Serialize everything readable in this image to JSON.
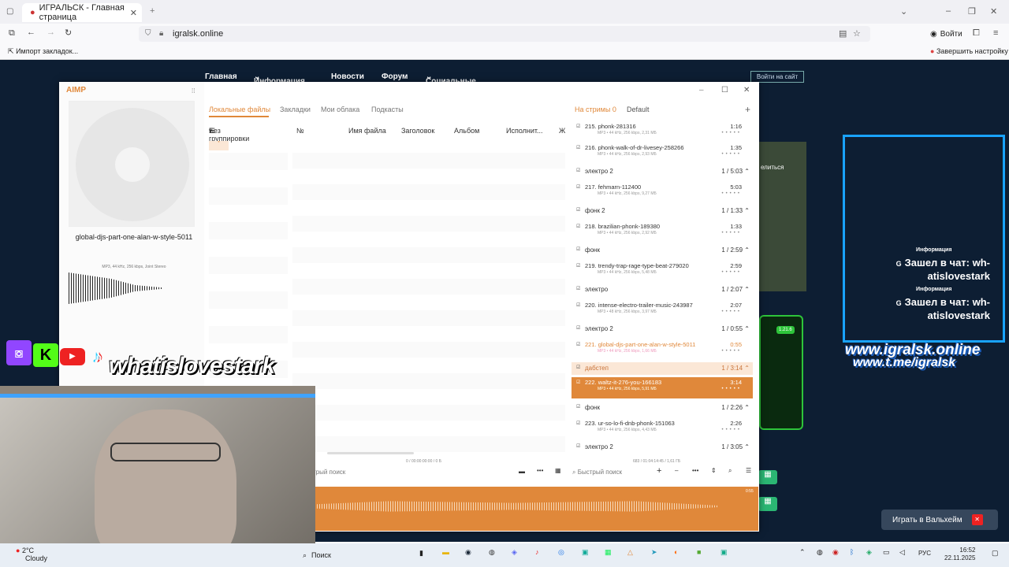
{
  "browser": {
    "tab_title": "ИГРАЛЬСК - Главная страница",
    "url": "igralsk.online",
    "login_label": "Войти",
    "import_bookmarks": "Импорт закладок...",
    "finish_setup": "Завершить настройку"
  },
  "site": {
    "nav": [
      "Главная",
      "Информация",
      "Новости",
      "Форум",
      "Социальные сети"
    ],
    "login_button": "Войти на сайт",
    "play_button": "Играть в Вальхейм",
    "side_text": "елиться",
    "version_badge": "1.21.6"
  },
  "aimp": {
    "logo": "AIMP",
    "now_playing_title": "global-djs-part-one-alan-w-style-5011",
    "now_playing_meta": "MP3, 44 kHz, 256 kbps, Joint Stereo",
    "tabs": [
      "Локальные файлы",
      "Закладки",
      "Мои облака",
      "Подкасты"
    ],
    "group_label": "Без группировки",
    "columns": [
      "№",
      "Имя файла",
      "Заголовок",
      "Альбом",
      "Исполнит...",
      "Ж"
    ],
    "playlist_tabs": [
      "На стримы 0",
      "Default"
    ],
    "library_status": "0 / 00:00:00:00 / 0 Б",
    "playlist_status": "683 / 01:04:14:45 / 1,61 ГБ",
    "quick_search_left": "Быстрый поиск",
    "quick_search_right": "Быстрый поиск",
    "wave_time": "0:55",
    "playlist": [
      {
        "kind": "track",
        "num": "215.",
        "name": "phonk-281316",
        "dur": "1:16",
        "meta": "MP3 • 44 kHz, 256 kbps, 2,31 МБ"
      },
      {
        "kind": "track",
        "num": "216.",
        "name": "phonk-walk-of-dr-livesey-258266",
        "dur": "1:35",
        "meta": "MP3 • 44 kHz, 256 kbps, 2,93 МБ"
      },
      {
        "kind": "group",
        "name": "электро 2",
        "dur": "1 / 5:03"
      },
      {
        "kind": "track",
        "num": "217.",
        "name": "fehmarn-112400",
        "dur": "5:03",
        "meta": "MP3 • 44 kHz, 256 kbps, 9,27 МБ"
      },
      {
        "kind": "group",
        "name": "фонк 2",
        "dur": "1 / 1:33"
      },
      {
        "kind": "track",
        "num": "218.",
        "name": "brazilian-phonk-189380",
        "dur": "1:33",
        "meta": "MP3 • 44 kHz, 256 kbps, 2,92 МБ"
      },
      {
        "kind": "group",
        "name": "фонк",
        "dur": "1 / 2:59"
      },
      {
        "kind": "track",
        "num": "219.",
        "name": "trendy-trap-rage-type-beat-279020",
        "dur": "2:59",
        "meta": "MP3 • 44 kHz, 256 kbps, 5,48 МБ"
      },
      {
        "kind": "group",
        "name": "электро",
        "dur": "1 / 2:07"
      },
      {
        "kind": "track",
        "num": "220.",
        "name": "intense-electro-trailer-music-243987",
        "dur": "2:07",
        "meta": "MP3 • 48 kHz, 256 kbps, 3,97 МБ"
      },
      {
        "kind": "group",
        "name": "электро 2",
        "dur": "1 / 0:55"
      },
      {
        "kind": "track",
        "num": "221.",
        "name": "global-djs-part-one-alan-w-style-5011",
        "dur": "0:55",
        "meta": "MP3 • 44 kHz, 256 kbps, 1,66 МБ",
        "state": "playing"
      },
      {
        "kind": "group",
        "name": "дабстеп",
        "dur": "1 / 3:14",
        "state": "selgroup"
      },
      {
        "kind": "track",
        "num": "222.",
        "name": "waltz-it-276-you-166183",
        "dur": "3:14",
        "meta": "MP3 • 44 kHz, 256 kbps, 5,91 МБ",
        "state": "selected"
      },
      {
        "kind": "group",
        "name": "фонк",
        "dur": "1 / 2:26"
      },
      {
        "kind": "track",
        "num": "223.",
        "name": "ur-so-lo-fi-dnb-phonk-151063",
        "dur": "2:26",
        "meta": "MP3 • 44 kHz, 256 kbps, 4,43 МБ"
      },
      {
        "kind": "group",
        "name": "электро 2",
        "dur": "1 / 3:05"
      }
    ]
  },
  "stream": {
    "chat": [
      {
        "label": "Информация",
        "msg": "Зашел в чат: wh-atislovestark"
      },
      {
        "label": "Информация",
        "msg": "Зашел в чат: wh-atislovestark"
      }
    ],
    "site_url": "www.igralsk.online",
    "tg_url": "www.t.me/igralsk",
    "nickname": "whatislovestark"
  },
  "taskbar": {
    "weather_temp": "2°C",
    "weather_desc": "Cloudy",
    "search": "Поиск",
    "lang": "РУС",
    "time": "16:52",
    "date": "22.11.2025"
  }
}
